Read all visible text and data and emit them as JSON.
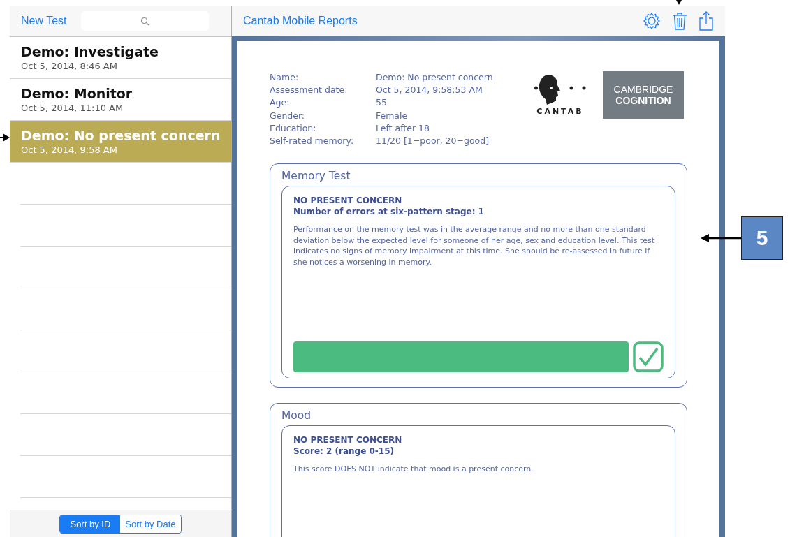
{
  "sidebar": {
    "new_button": "New Test",
    "items": [
      {
        "title": "Demo: Investigate",
        "date": "Oct 5, 2014, 8:46 AM",
        "selected": false
      },
      {
        "title": "Demo: Monitor",
        "date": "Oct 5, 2014, 11:10 AM",
        "selected": false
      },
      {
        "title": "Demo: No present concern",
        "date": "Oct 5, 2014, 9:58 AM",
        "selected": true
      }
    ],
    "sort": [
      {
        "label": "Sort by ID",
        "selected": true
      },
      {
        "label": "Sort by Date",
        "selected": false
      }
    ]
  },
  "header": {
    "title": "Cantab Mobile Reports"
  },
  "report": {
    "details": [
      {
        "label": "Name:",
        "value": "Demo: No present concern"
      },
      {
        "label": "Assessment date:",
        "value": "Oct 5, 2014, 9:58:53 AM"
      },
      {
        "label": "Age:",
        "value": "55"
      },
      {
        "label": "Gender:",
        "value": "Female"
      },
      {
        "label": "Education:",
        "value": "Left after 18"
      },
      {
        "label": "Self-rated memory:",
        "value": "11/20 [1=poor, 20=good]"
      }
    ],
    "logo_text": "CANTAB",
    "brand_lines": [
      "CAMBRIDGE",
      "COGNITION"
    ],
    "sections": [
      {
        "title": "Memory Test",
        "verdict": "NO PRESENT CONCERN",
        "score": "Number of errors at six-pattern stage: 1",
        "text": "Performance on the memory test was in the average range and no more than one standard deviation below the expected level for someone of her age, sex and education level.  This test indicates no signs of memory impairment at this time. She should be re-assessed in future if she notices a worsening in memory.",
        "result": {
          "passed": true
        }
      },
      {
        "title": "Mood",
        "verdict": "NO PRESENT CONCERN",
        "score": "Score: 2 (range 0-15)",
        "text": "This score DOES NOT indicate that mood is a present concern."
      }
    ]
  },
  "callout": "5"
}
